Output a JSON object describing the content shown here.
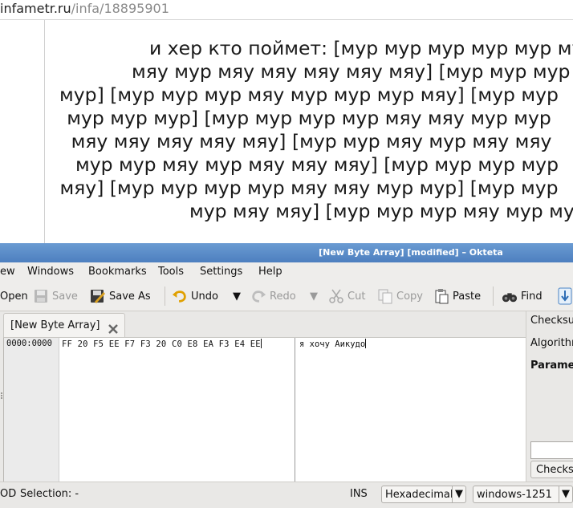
{
  "browser": {
    "url_host": "infametr.ru",
    "url_path": "/infa/18895901"
  },
  "page": {
    "lines": [
      "и хер кто поймет: [мур мур мур мур мур мур",
      "мяу мур мяу мяу мяу мяу мяу] [мур мур мур мур",
      "мур] [мур мур мур мяу мур мур мур мяу] [мур мур",
      "мур мур мур] [мур мур мур мур мяу мяу мур мур",
      "мяу мяу мяу мяу мяу] [мур мур мяу мур мяу мяу",
      "мур мур мяу мур мяу мяу мяу] [мур мур мур мур",
      "мяу] [мур мур мур мур мяу мяу мур мур] [мур мур",
      "мур мяу мяу] [мур мур мур мяу мур мур"
    ]
  },
  "window": {
    "title": "[New Byte Array] [modified] – Okteta"
  },
  "menu": {
    "view": "ew",
    "windows": "Windows",
    "bookmarks": "Bookmarks",
    "tools": "Tools",
    "settings": "Settings",
    "help": "Help"
  },
  "toolbar": {
    "open": "Open",
    "save": "Save",
    "save_as": "Save As",
    "undo": "Undo",
    "redo": "Redo",
    "cut": "Cut",
    "copy": "Copy",
    "paste": "Paste",
    "find": "Find"
  },
  "tab": {
    "label": "[New Byte Array]"
  },
  "editor": {
    "offset": "0000:0000",
    "hex": "FF 20 F5 EE  F7 F3 20 C0  E8 EA F3 E4  EE",
    "chars": "я хочу Аикудо"
  },
  "right_panel": {
    "checksum": "Checksu",
    "algorithm": "Algorithr",
    "parameters": "Parame",
    "calc_button": "Checks"
  },
  "status": {
    "mode_prefix": "OD",
    "selection": "Selection: -",
    "ins": "INS",
    "encoding_view": "Hexadecimal",
    "charset": "windows-1251"
  },
  "colors": {
    "titlebar": "#5a8bc8",
    "chrome": "#e9e8e6",
    "disabled_text": "#9a9a9a"
  }
}
